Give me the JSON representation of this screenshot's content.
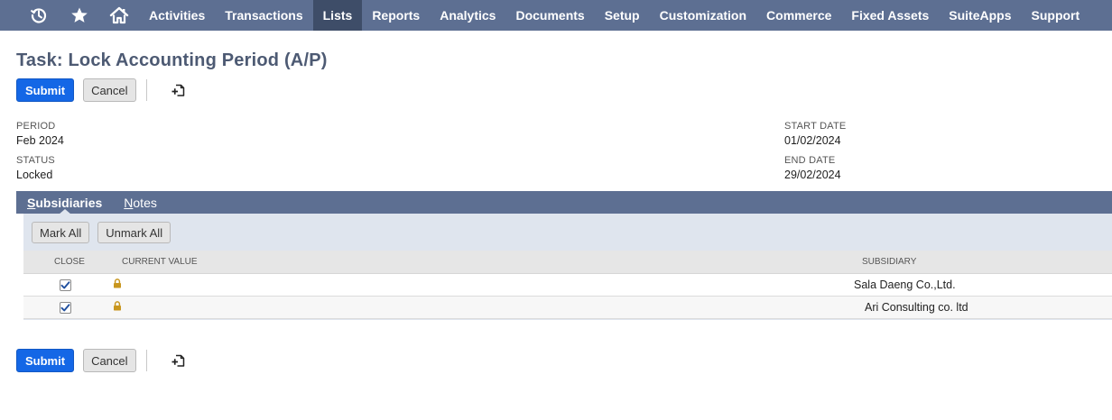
{
  "nav": {
    "icons": [
      "recent-records-icon",
      "favorites-star-icon",
      "home-icon"
    ],
    "items": [
      {
        "label": "Activities",
        "active": false
      },
      {
        "label": "Transactions",
        "active": false
      },
      {
        "label": "Lists",
        "active": true
      },
      {
        "label": "Reports",
        "active": false
      },
      {
        "label": "Analytics",
        "active": false
      },
      {
        "label": "Documents",
        "active": false
      },
      {
        "label": "Setup",
        "active": false
      },
      {
        "label": "Customization",
        "active": false
      },
      {
        "label": "Commerce",
        "active": false
      },
      {
        "label": "Fixed Assets",
        "active": false
      },
      {
        "label": "SuiteApps",
        "active": false
      },
      {
        "label": "Support",
        "active": false
      }
    ]
  },
  "page": {
    "title": "Task: Lock Accounting Period (A/P)"
  },
  "actions": {
    "submit_label": "Submit",
    "cancel_label": "Cancel",
    "extra_icon": "add-to-shortcuts-icon"
  },
  "fields": {
    "period": {
      "label": "PERIOD",
      "value": "Feb 2024"
    },
    "status": {
      "label": "STATUS",
      "value": "Locked"
    },
    "start_date": {
      "label": "START DATE",
      "value": "01/02/2024"
    },
    "end_date": {
      "label": "END DATE",
      "value": "29/02/2024"
    }
  },
  "subtabs": {
    "items": [
      {
        "first": "S",
        "rest": "ubsidiaries",
        "active": true
      },
      {
        "first": "N",
        "rest": "otes",
        "active": false
      }
    ]
  },
  "panel": {
    "mark_all_label": "Mark All",
    "unmark_all_label": "Unmark All",
    "columns": {
      "close": "CLOSE",
      "current_value": "CURRENT VALUE",
      "subsidiary": "SUBSIDIARY"
    },
    "rows": [
      {
        "close": true,
        "current_value_icon": "lock-icon",
        "subsidiary": "Sala Daeng Co.,Ltd."
      },
      {
        "close": true,
        "current_value_icon": "lock-icon",
        "subsidiary": "Ari Consulting co. ltd"
      }
    ]
  },
  "colors": {
    "nav_bg": "#5d6f92",
    "nav_active": "#3e4d68",
    "primary_button": "#1467e6",
    "lock": "#c8961e"
  }
}
